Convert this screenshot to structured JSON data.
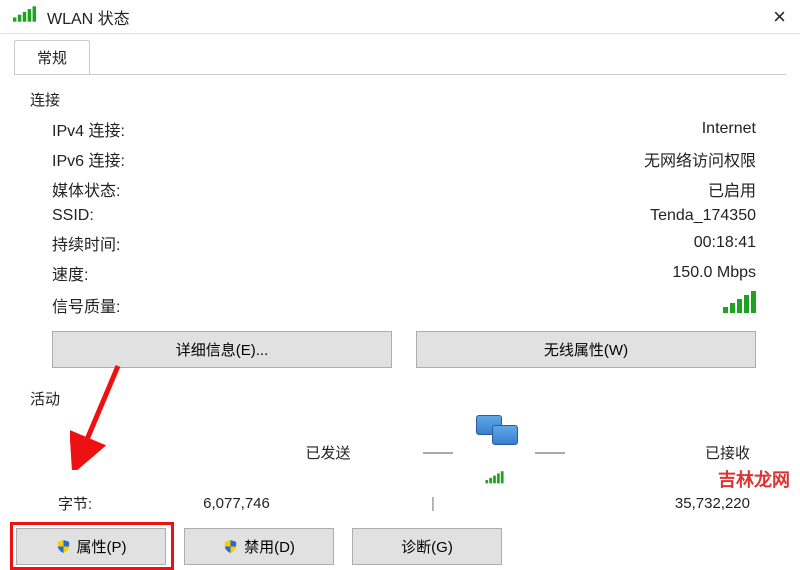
{
  "window": {
    "title": "WLAN 状态",
    "close": "×"
  },
  "tabs": {
    "general": "常规"
  },
  "connection": {
    "section_title": "连接",
    "rows": {
      "ipv4_label": "IPv4 连接:",
      "ipv4_value": "Internet",
      "ipv6_label": "IPv6 连接:",
      "ipv6_value": "无网络访问权限",
      "media_label": "媒体状态:",
      "media_value": "已启用",
      "ssid_label": "SSID:",
      "ssid_value": "Tenda_174350",
      "duration_label": "持续时间:",
      "duration_value": "00:18:41",
      "speed_label": "速度:",
      "speed_value": "150.0 Mbps",
      "signal_label": "信号质量:"
    },
    "buttons": {
      "details": "详细信息(E)...",
      "wireless_props": "无线属性(W)"
    }
  },
  "activity": {
    "section_title": "活动",
    "sent_label": "已发送",
    "received_label": "已接收",
    "bytes_label": "字节:",
    "sent_value": "6,077,746",
    "received_value": "35,732,220"
  },
  "footer_buttons": {
    "properties": "属性(P)",
    "disable": "禁用(D)",
    "diagnose": "诊断(G)"
  },
  "watermark": "吉林龙网"
}
